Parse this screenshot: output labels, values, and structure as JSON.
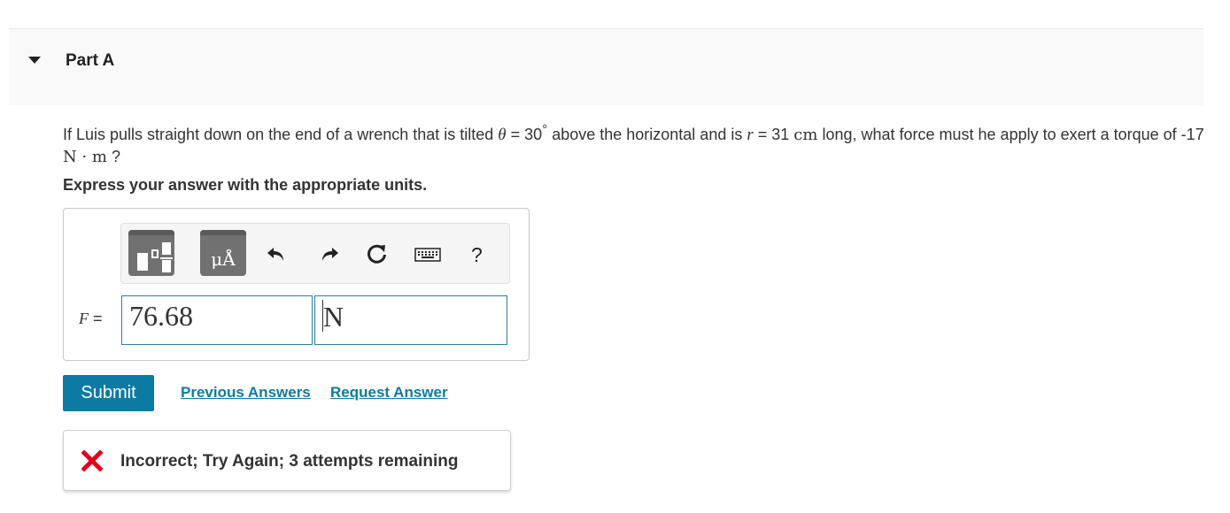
{
  "part": {
    "title": "Part A"
  },
  "question": {
    "text_1": "If Luis pulls straight down on the end of a wrench that is tilted ",
    "theta_symbol": "θ",
    "theta_eq": " = 30",
    "degree": "°",
    "text_2": " above the horizontal and is ",
    "r_symbol": "r",
    "r_eq": " = 31 ",
    "r_unit": "cm",
    "text_3": " long, what force must he apply to exert a torque of -17 ",
    "torque_unit": "N · m",
    "text_4": " ?"
  },
  "instruction": "Express your answer with the appropriate units.",
  "toolbar": {
    "units_glyph": "μÅ",
    "help": "?"
  },
  "answer": {
    "variable": "F",
    "equals": " =",
    "value": "76.68",
    "unit": "N"
  },
  "actions": {
    "submit": "Submit",
    "previous_answers": "Previous Answers",
    "request_answer": "Request Answer"
  },
  "feedback": {
    "message": "Incorrect; Try Again; 3 attempts remaining",
    "icon": "x-mark-icon",
    "color": "#e2001a"
  },
  "colors": {
    "accent": "#0c7ba3",
    "field_border": "#2e7ea0"
  }
}
